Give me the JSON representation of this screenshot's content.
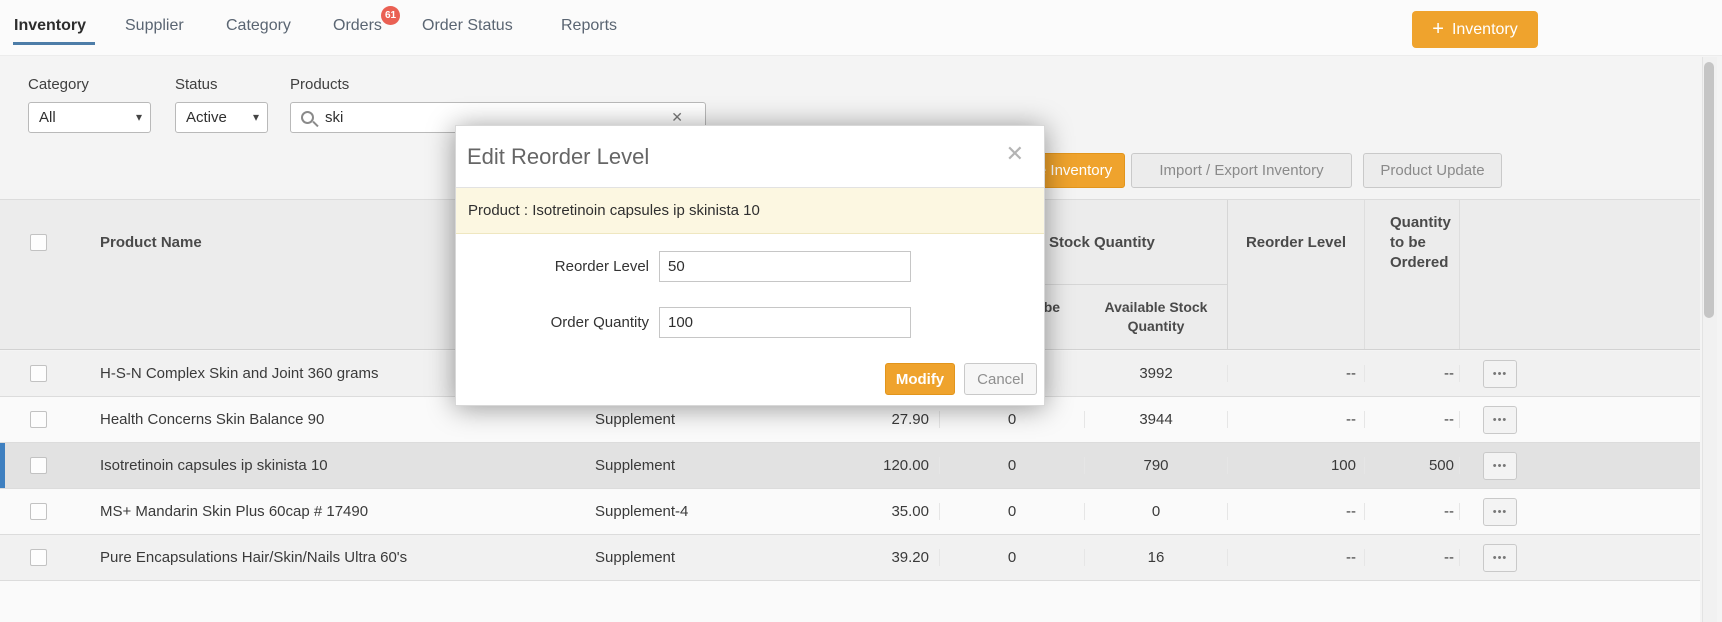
{
  "nav": {
    "items": [
      {
        "label": "Inventory",
        "active": true
      },
      {
        "label": "Supplier"
      },
      {
        "label": "Category"
      },
      {
        "label": "Orders",
        "badge": "61"
      },
      {
        "label": "Order Status"
      },
      {
        "label": "Reports"
      }
    ],
    "add_button": {
      "icon": "+",
      "label": "Inventory"
    }
  },
  "filters": {
    "category_label": "Category",
    "category_value": "All",
    "status_label": "Status",
    "status_value": "Active",
    "products_label": "Products",
    "search_value": "ski"
  },
  "toolbar": {
    "update_inventory": "Update Inventory",
    "import_export": "Import / Export Inventory",
    "product_update": "Product Update"
  },
  "table": {
    "headers": {
      "product_name": "Product Name",
      "stock_quantity": "Stock Quantity",
      "reorder_level": "Reorder Level",
      "quantity_to_be_ordered": "Quantity to be Ordered",
      "sub_qty_to_be_delivered": "Quantity to be Delivered",
      "sub_available_stock": "Available Stock Quantity"
    },
    "rows": [
      {
        "product_name": "H-S-N Complex Skin and Joint 360 grams",
        "category": "",
        "price": "",
        "qty_to_be_delivered": "",
        "available_stock": "3992",
        "reorder_level": "--",
        "qty_to_be_ordered": "--"
      },
      {
        "product_name": "Health Concerns Skin Balance 90",
        "category": "Supplement",
        "price": "27.90",
        "qty_to_be_delivered": "0",
        "available_stock": "3944",
        "reorder_level": "--",
        "qty_to_be_ordered": "--"
      },
      {
        "product_name": "Isotretinoin capsules ip skinista 10",
        "category": "Supplement",
        "price": "120.00",
        "qty_to_be_delivered": "0",
        "available_stock": "790",
        "reorder_level": "100",
        "qty_to_be_ordered": "500",
        "selected": true
      },
      {
        "product_name": "MS+ Mandarin Skin Plus 60cap # 17490",
        "category": "Supplement-4",
        "price": "35.00",
        "qty_to_be_delivered": "0",
        "available_stock": "0",
        "reorder_level": "--",
        "qty_to_be_ordered": "--"
      },
      {
        "product_name": "Pure Encapsulations Hair/Skin/Nails Ultra 60's",
        "category": "Supplement",
        "price": "39.20",
        "qty_to_be_delivered": "0",
        "available_stock": "16",
        "reorder_level": "--",
        "qty_to_be_ordered": "--"
      }
    ]
  },
  "modal": {
    "title": "Edit Reorder Level",
    "product_line": "Product : Isotretinoin capsules ip skinista 10",
    "reorder_label": "Reorder Level",
    "reorder_value": "50",
    "order_qty_label": "Order Quantity",
    "order_qty_value": "100",
    "modify_label": "Modify",
    "cancel_label": "Cancel"
  },
  "icons": {
    "caret": "▾",
    "clear": "✕",
    "close": "✕",
    "dots": "•••"
  },
  "colors": {
    "accent_orange": "#efa32d",
    "badge_red": "#ea6053",
    "selected_bar_blue": "#3f80c0",
    "banner_yellow": "#fcf7e1"
  }
}
